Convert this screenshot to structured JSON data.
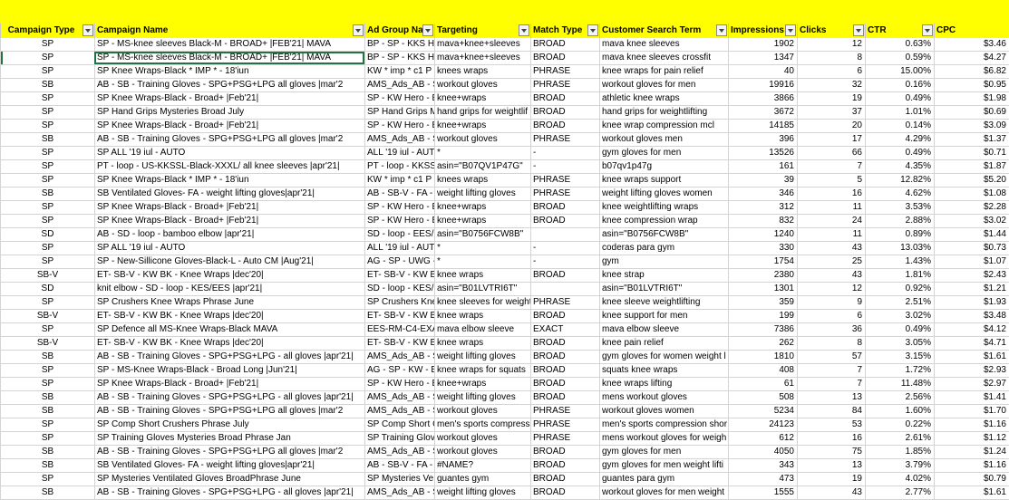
{
  "headers": {
    "campaign_type": "Campaign Type",
    "campaign_name": "Campaign Name",
    "ad_group": "Ad Group Na",
    "targeting": "Targeting",
    "match_type": "Match Type",
    "search_term": "Customer Search Term",
    "impressions": "Impressions",
    "clicks": "Clicks",
    "ctr": "CTR",
    "cpc": "CPC"
  },
  "rows": [
    {
      "type": "SP",
      "name": "SP - MS-knee sleeves Black-M - BROAD+ |FEB'21| MAVA",
      "adgroup": "BP - SP - KKS HEF",
      "targeting": "mava+knee+sleeves",
      "match": "BROAD",
      "term": "mava knee sleeves",
      "impressions": "1902",
      "clicks": "12",
      "ctr": "0.63%",
      "cpc": "$3.46"
    },
    {
      "type": "SP",
      "name": "SP - MS-knee sleeves Black-M - BROAD+ |FEB'21| MAVA",
      "adgroup": "BP - SP - KKS HEF",
      "targeting": "mava+knee+sleeves",
      "match": "BROAD",
      "term": "mava knee sleeves crossfit",
      "impressions": "1347",
      "clicks": "8",
      "ctr": "0.59%",
      "cpc": "$4.27"
    },
    {
      "type": "SP",
      "name": "SP Knee Wraps-Black * IMP * - 18'iun",
      "adgroup": "KW * imp * c1 P",
      "targeting": "knees wraps",
      "match": "PHRASE",
      "term": "knee wraps for pain relief",
      "impressions": "40",
      "clicks": "6",
      "ctr": "15.00%",
      "cpc": "$6.82"
    },
    {
      "type": "SB",
      "name": "AB - SB - Training Gloves - SPG+PSG+LPG all gloves |mar'2",
      "adgroup": "AMS_Ads_AB - S",
      "targeting": "workout gloves",
      "match": "PHRASE",
      "term": "workout gloves for men",
      "impressions": "19916",
      "clicks": "32",
      "ctr": "0.16%",
      "cpc": "$0.95"
    },
    {
      "type": "SP",
      "name": "SP Knee Wraps-Black - Broad+ |Feb'21|",
      "adgroup": "SP - KW Hero - B",
      "targeting": "knee+wraps",
      "match": "BROAD",
      "term": "athletic knee wraps",
      "impressions": "3866",
      "clicks": "19",
      "ctr": "0.49%",
      "cpc": "$1.98"
    },
    {
      "type": "SP",
      "name": "SP Hand Grips Mysteries Broad July",
      "adgroup": "SP Hand Grips M",
      "targeting": "hand grips for weightlif",
      "match": "BROAD",
      "term": "hand grips for weightlifting",
      "impressions": "3672",
      "clicks": "37",
      "ctr": "1.01%",
      "cpc": "$0.69"
    },
    {
      "type": "SP",
      "name": "SP Knee Wraps-Black - Broad+ |Feb'21|",
      "adgroup": "SP - KW Hero - B",
      "targeting": "knee+wraps",
      "match": "BROAD",
      "term": "knee wrap compression mcl",
      "impressions": "14185",
      "clicks": "20",
      "ctr": "0.14%",
      "cpc": "$3.09"
    },
    {
      "type": "SB",
      "name": "AB - SB - Training Gloves - SPG+PSG+LPG all gloves |mar'2",
      "adgroup": "AMS_Ads_AB - S",
      "targeting": "workout gloves",
      "match": "PHRASE",
      "term": "workout gloves men",
      "impressions": "396",
      "clicks": "17",
      "ctr": "4.29%",
      "cpc": "$1.37"
    },
    {
      "type": "SP",
      "name": "SP ALL '19 iul - AUTO",
      "adgroup": "ALL '19 iul - AUT",
      "targeting": "*",
      "match": "-",
      "term": "gym gloves for men",
      "impressions": "13526",
      "clicks": "66",
      "ctr": "0.49%",
      "cpc": "$0.71"
    },
    {
      "type": "SP",
      "name": "PT - loop - US-KKSSL-Black-XXXL/ all knee sleeves |apr'21|",
      "adgroup": "PT - loop - KKSSL",
      "targeting": "asin=\"B07QV1P47G\"",
      "match": "-",
      "term": "b07qv1p47g",
      "impressions": "161",
      "clicks": "7",
      "ctr": "4.35%",
      "cpc": "$1.87"
    },
    {
      "type": "SP",
      "name": "SP Knee Wraps-Black * IMP * - 18'iun",
      "adgroup": "KW * imp * c1 P",
      "targeting": "knees wraps",
      "match": "PHRASE",
      "term": "knee wraps support",
      "impressions": "39",
      "clicks": "5",
      "ctr": "12.82%",
      "cpc": "$5.20"
    },
    {
      "type": "SB",
      "name": "SB Ventilated Gloves- FA - weight lifting gloves|apr'21|",
      "adgroup": "AB - SB-V - FA - v",
      "targeting": "weight lifting gloves",
      "match": "PHRASE",
      "term": "weight lifting gloves women",
      "impressions": "346",
      "clicks": "16",
      "ctr": "4.62%",
      "cpc": "$1.08"
    },
    {
      "type": "SP",
      "name": "SP Knee Wraps-Black - Broad+ |Feb'21|",
      "adgroup": "SP - KW Hero - B",
      "targeting": "knee+wraps",
      "match": "BROAD",
      "term": "knee weightlifting wraps",
      "impressions": "312",
      "clicks": "11",
      "ctr": "3.53%",
      "cpc": "$2.28"
    },
    {
      "type": "SP",
      "name": "SP Knee Wraps-Black - Broad+ |Feb'21|",
      "adgroup": "SP - KW Hero - B",
      "targeting": "knee+wraps",
      "match": "BROAD",
      "term": "knee compression wrap",
      "impressions": "832",
      "clicks": "24",
      "ctr": "2.88%",
      "cpc": "$3.02"
    },
    {
      "type": "SD",
      "name": "AB - SD - loop - bamboo elbow |apr'21|",
      "adgroup": "SD - loop - EES/K",
      "targeting": "asin=\"B0756FCW8B\"",
      "match": "",
      "term": "asin=\"B0756FCW8B\"",
      "impressions": "1240",
      "clicks": "11",
      "ctr": "0.89%",
      "cpc": "$1.44"
    },
    {
      "type": "SP",
      "name": "SP ALL '19 iul - AUTO",
      "adgroup": "ALL '19 iul - AUT",
      "targeting": "*",
      "match": "-",
      "term": "coderas para gym",
      "impressions": "330",
      "clicks": "43",
      "ctr": "13.03%",
      "cpc": "$0.73"
    },
    {
      "type": "SP",
      "name": "SP - New-Sillicone Gloves-Black-L - Auto CM |Aug'21|",
      "adgroup": "AG - SP - UWG -",
      "targeting": "*",
      "match": "-",
      "term": "gym",
      "impressions": "1754",
      "clicks": "25",
      "ctr": "1.43%",
      "cpc": "$1.07"
    },
    {
      "type": "SB-V",
      "name": "ET- SB-V - KW BK - Knee Wraps |dec'20|",
      "adgroup": "ET- SB-V - KW B",
      "targeting": "knee wraps",
      "match": "BROAD",
      "term": "knee strap",
      "impressions": "2380",
      "clicks": "43",
      "ctr": "1.81%",
      "cpc": "$2.43"
    },
    {
      "type": "SD",
      "name": "knit elbow - SD - loop - KES/EES |apr'21|",
      "adgroup": "SD - loop - KES/E",
      "targeting": "asin=\"B01LVTRI6T\"",
      "match": "",
      "term": "asin=\"B01LVTRI6T\"",
      "impressions": "1301",
      "clicks": "12",
      "ctr": "0.92%",
      "cpc": "$1.21"
    },
    {
      "type": "SP",
      "name": "SP Crushers Knee Wraps Phrase June",
      "adgroup": "SP Crushers Kne",
      "targeting": "knee sleeves for weight",
      "match": "PHRASE",
      "term": "knee sleeve weightlifting",
      "impressions": "359",
      "clicks": "9",
      "ctr": "2.51%",
      "cpc": "$1.93"
    },
    {
      "type": "SB-V",
      "name": "ET- SB-V - KW BK - Knee Wraps |dec'20|",
      "adgroup": "ET- SB-V - KW B",
      "targeting": "knee wraps",
      "match": "BROAD",
      "term": "knee support for men",
      "impressions": "199",
      "clicks": "6",
      "ctr": "3.02%",
      "cpc": "$3.48"
    },
    {
      "type": "SP",
      "name": "SP Defence all MS-Knee Wraps-Black MAVA",
      "adgroup": "EES-RM-C4-EXAC",
      "targeting": "mava elbow sleeve",
      "match": "EXACT",
      "term": "mava elbow sleeve",
      "impressions": "7386",
      "clicks": "36",
      "ctr": "0.49%",
      "cpc": "$4.12"
    },
    {
      "type": "SB-V",
      "name": "ET- SB-V - KW BK - Knee Wraps |dec'20|",
      "adgroup": "ET- SB-V - KW B",
      "targeting": "knee wraps",
      "match": "BROAD",
      "term": "knee pain relief",
      "impressions": "262",
      "clicks": "8",
      "ctr": "3.05%",
      "cpc": "$4.71"
    },
    {
      "type": "SB",
      "name": "AB - SB - Training Gloves - SPG+PSG+LPG - all gloves |apr'21|",
      "adgroup": "AMS_Ads_AB - S",
      "targeting": "weight lifting gloves",
      "match": "BROAD",
      "term": "gym gloves for women weight l",
      "impressions": "1810",
      "clicks": "57",
      "ctr": "3.15%",
      "cpc": "$1.61"
    },
    {
      "type": "SP",
      "name": "SP - MS-Knee Wraps-Black - Broad Long |Jun'21|",
      "adgroup": "AG - SP - KW - B",
      "targeting": "knee wraps for squats",
      "match": "BROAD",
      "term": "squats knee wraps",
      "impressions": "408",
      "clicks": "7",
      "ctr": "1.72%",
      "cpc": "$2.93"
    },
    {
      "type": "SP",
      "name": "SP Knee Wraps-Black - Broad+ |Feb'21|",
      "adgroup": "SP - KW Hero - B",
      "targeting": "knee+wraps",
      "match": "BROAD",
      "term": "knee wraps lifting",
      "impressions": "61",
      "clicks": "7",
      "ctr": "11.48%",
      "cpc": "$2.97"
    },
    {
      "type": "SB",
      "name": "AB - SB - Training Gloves - SPG+PSG+LPG - all gloves |apr'21|",
      "adgroup": "AMS_Ads_AB - S",
      "targeting": "weight lifting gloves",
      "match": "BROAD",
      "term": "mens workout gloves",
      "impressions": "508",
      "clicks": "13",
      "ctr": "2.56%",
      "cpc": "$1.41"
    },
    {
      "type": "SB",
      "name": "AB - SB - Training Gloves - SPG+PSG+LPG all gloves |mar'2",
      "adgroup": "AMS_Ads_AB - S",
      "targeting": "workout gloves",
      "match": "PHRASE",
      "term": "workout gloves women",
      "impressions": "5234",
      "clicks": "84",
      "ctr": "1.60%",
      "cpc": "$1.70"
    },
    {
      "type": "SP",
      "name": "SP Comp Short Crushers Phrase July",
      "adgroup": "SP Comp Short C",
      "targeting": "men's sports compressi",
      "match": "PHRASE",
      "term": "men's sports compression shor",
      "impressions": "24123",
      "clicks": "53",
      "ctr": "0.22%",
      "cpc": "$1.16"
    },
    {
      "type": "SP",
      "name": "SP Training Gloves Mysteries Broad Phrase Jan",
      "adgroup": "SP Training Glov",
      "targeting": "workout gloves",
      "match": "PHRASE",
      "term": "mens workout gloves for weigh",
      "impressions": "612",
      "clicks": "16",
      "ctr": "2.61%",
      "cpc": "$1.12"
    },
    {
      "type": "SB",
      "name": "AB - SB - Training Gloves - SPG+PSG+LPG all gloves |mar'2",
      "adgroup": "AMS_Ads_AB - S",
      "targeting": "workout gloves",
      "match": "BROAD",
      "term": "gym gloves for men",
      "impressions": "4050",
      "clicks": "75",
      "ctr": "1.85%",
      "cpc": "$1.24"
    },
    {
      "type": "SB",
      "name": "SB Ventilated Gloves- FA - weight lifting gloves|apr'21|",
      "adgroup": "AB - SB-V - FA - v",
      "targeting": "#NAME?",
      "match": "BROAD",
      "term": "gym gloves for men weight lifti",
      "impressions": "343",
      "clicks": "13",
      "ctr": "3.79%",
      "cpc": "$1.16"
    },
    {
      "type": "SP",
      "name": "SP Mysteries Ventilated Gloves BroadPhrase June",
      "adgroup": "SP Mysteries Ve",
      "targeting": "guantes gym",
      "match": "BROAD",
      "term": "guantes para gym",
      "impressions": "473",
      "clicks": "19",
      "ctr": "4.02%",
      "cpc": "$0.79"
    },
    {
      "type": "SB",
      "name": "AB - SB - Training Gloves - SPG+PSG+LPG - all gloves |apr'21|",
      "adgroup": "AMS_Ads_AB - S",
      "targeting": "weight lifting gloves",
      "match": "BROAD",
      "term": "workout gloves for men weight",
      "impressions": "1555",
      "clicks": "43",
      "ctr": "2.77%",
      "cpc": "$1.61"
    }
  ],
  "selected_row_index": 1
}
